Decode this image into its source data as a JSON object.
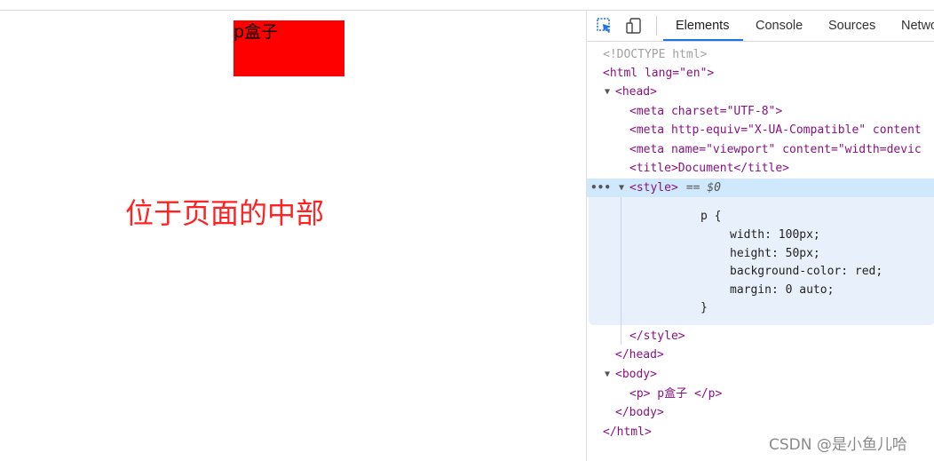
{
  "page": {
    "p_box_text": "p盒子",
    "annotation": "位于页面的中部"
  },
  "devtools": {
    "tabs": [
      "Elements",
      "Console",
      "Sources",
      "Netwo"
    ],
    "icons": [
      "inspect-element-icon",
      "device-toolbar-icon"
    ],
    "source": {
      "doctype": "<!DOCTYPE html>",
      "html_open": "<html lang=\"en\">",
      "head_open": "<head>",
      "meta1": "<meta charset=\"UTF-8\">",
      "meta2": "<meta http-equiv=\"X-UA-Compatible\" content",
      "meta3": "<meta name=\"viewport\" content=\"width=devic",
      "title": "<title>Document</title>",
      "style_open": "<style>",
      "style_marker": " == $0",
      "css_selector": "p {",
      "css_width": "width: 100px;",
      "css_height": "height: 50px;",
      "css_bg": "background-color: red;",
      "css_margin": "margin: 0 auto;",
      "css_close": "}",
      "style_close": "</style>",
      "head_close": "</head>",
      "body_open": "<body>",
      "p_elem": "<p> p盒子 </p>",
      "body_close": "</body>",
      "html_close": "</html>"
    },
    "selected_dots": "•••"
  },
  "watermark": "CSDN @是小鱼儿哈",
  "colors": {
    "p_box_bg": "#ff0000",
    "annotation": "#ff2222",
    "tab_underline": "#1a73e8",
    "selected_row": "#cfe8fc",
    "tag": "#881280",
    "attr_name": "#994500",
    "attr_value": "#1a1aa6"
  }
}
